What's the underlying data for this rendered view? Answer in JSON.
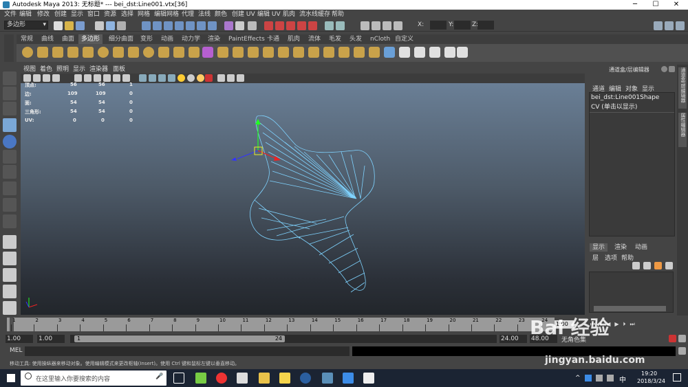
{
  "titlebar": {
    "title": "Autodesk Maya 2013: 无标题*    ---    bei_dst:Line001.vtx[36]",
    "minimize": "─",
    "maximize": "☐",
    "close": "✕"
  },
  "menubar": [
    "文件",
    "编辑",
    "修改",
    "创建",
    "显示",
    "窗口",
    "资源",
    "选择",
    "网格",
    "编辑网格",
    "代理",
    "法线",
    "颜色",
    "创建 UV",
    "编辑 UV",
    "肌肉",
    "流水线缓存",
    "帮助"
  ],
  "statusline": {
    "mode": "多边形",
    "x_label": "X:",
    "y_label": "Y:",
    "z_label": "Z:"
  },
  "shelf": {
    "tabs": [
      "常规",
      "曲线",
      "曲面",
      "多边形",
      "细分曲面",
      "变形",
      "动画",
      "动力学",
      "渲染",
      "PaintEffects",
      "卡通",
      "肌肉",
      "流体",
      "毛发",
      "头发",
      "nCloth",
      "自定义"
    ],
    "active": "多边形"
  },
  "viewport": {
    "menu": [
      "视图",
      "着色",
      "照明",
      "显示",
      "渲染器",
      "面板"
    ],
    "hud": {
      "labels": [
        "顶点:",
        "边:",
        "面:",
        "三角形:",
        "UV:"
      ],
      "col1": [
        "56",
        "109",
        "54",
        "54",
        "0"
      ],
      "col2": [
        "56",
        "109",
        "54",
        "54",
        "0"
      ],
      "col3": [
        "1",
        "0",
        "0",
        "0",
        "0"
      ]
    }
  },
  "channelbox": {
    "title": "通道盒/层编辑器",
    "menu": [
      "通道",
      "编辑",
      "对象",
      "显示"
    ],
    "object": "bei_dst:Line001Shape",
    "subtitle": "CV (单击以显示)"
  },
  "layer": {
    "tabs": [
      "显示",
      "渲染",
      "动画"
    ],
    "menu": [
      "层",
      "选项",
      "帮助"
    ]
  },
  "side_tabs": [
    "通道盒/层编辑器",
    "属性编辑器"
  ],
  "timeslider": {
    "ticks": [
      "1",
      "2",
      "3",
      "4",
      "5",
      "6",
      "7",
      "8",
      "9",
      "10",
      "11",
      "12",
      "13",
      "14",
      "15",
      "16",
      "17",
      "18",
      "19",
      "20",
      "21",
      "22",
      "23",
      "24"
    ],
    "current": "1.00"
  },
  "range": {
    "start": "1.00",
    "start2": "1.00",
    "slider_start": "1",
    "slider_end": "24",
    "end": "24.00",
    "end2": "48.00",
    "anim_layer": "无角色集"
  },
  "cmd": {
    "label": "MEL"
  },
  "helpline": "移动工具: 使用操纵器来移动对象。使用编辑模式来更改枢轴(Insert)。使用 Ctrl 键和鼠标左键以垂直移动。",
  "taskbar": {
    "search": "在这里输入你要搜索的内容",
    "ime": "中",
    "time": "19:20",
    "date": "2018/3/24"
  },
  "watermark": {
    "brand": "Bai 经验",
    "url": "jingyan.baidu.com"
  }
}
